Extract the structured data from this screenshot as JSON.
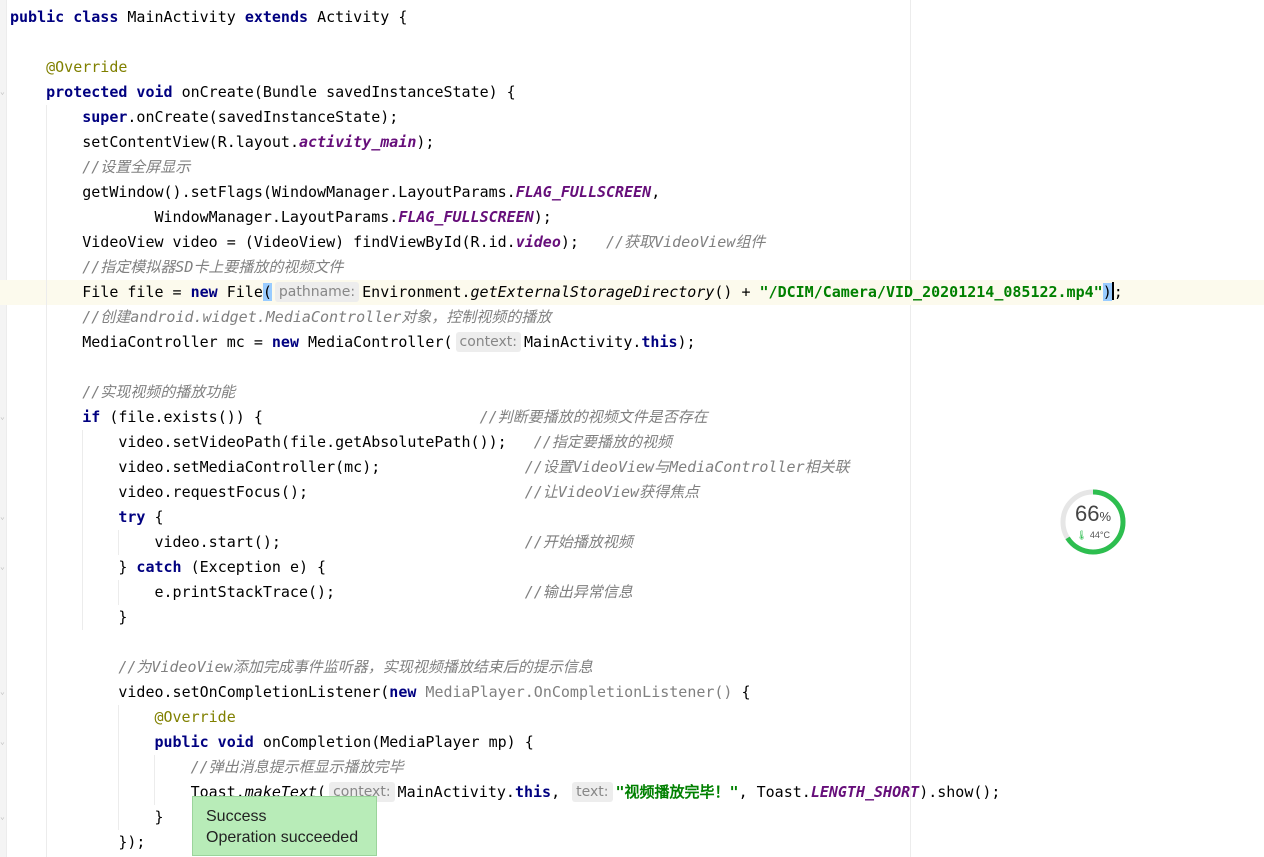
{
  "editor": {
    "lines": [
      {
        "indent": 0,
        "tokens": [
          [
            "kw",
            "public class "
          ],
          [
            "",
            "MainActivity "
          ],
          [
            "kw",
            "extends "
          ],
          [
            "",
            "Activity {"
          ]
        ]
      },
      {
        "indent": 0,
        "tokens": []
      },
      {
        "indent": 4,
        "tokens": [
          [
            "ann",
            "@Override"
          ]
        ]
      },
      {
        "indent": 4,
        "tokens": [
          [
            "kw",
            "protected void "
          ],
          [
            "",
            "onCreate(Bundle savedInstanceState) {"
          ]
        ]
      },
      {
        "indent": 8,
        "tokens": [
          [
            "kw",
            "super"
          ],
          [
            "",
            ".onCreate(savedInstanceState);"
          ]
        ]
      },
      {
        "indent": 8,
        "tokens": [
          [
            "",
            "setContentView(R.layout."
          ],
          [
            "fld",
            "activity_main"
          ],
          [
            "",
            ");"
          ]
        ]
      },
      {
        "indent": 8,
        "tokens": [
          [
            "cm",
            "//设置全屏显示"
          ]
        ]
      },
      {
        "indent": 8,
        "tokens": [
          [
            "",
            "getWindow().setFlags(WindowManager.LayoutParams."
          ],
          [
            "fld",
            "FLAG_FULLSCREEN"
          ],
          [
            "",
            ","
          ]
        ]
      },
      {
        "indent": 16,
        "tokens": [
          [
            "",
            "WindowManager.LayoutParams."
          ],
          [
            "fld",
            "FLAG_FULLSCREEN"
          ],
          [
            "",
            ");"
          ]
        ]
      },
      {
        "indent": 8,
        "tokens": [
          [
            "",
            "VideoView video = (VideoView) findViewById(R.id."
          ],
          [
            "fld",
            "video"
          ],
          [
            "",
            ");   "
          ],
          [
            "cm",
            "//获取VideoView组件"
          ]
        ]
      },
      {
        "indent": 8,
        "tokens": [
          [
            "cm",
            "//指定模拟器SD卡上要播放的视频文件"
          ]
        ]
      },
      {
        "indent": 8,
        "current": true,
        "tokens": [
          [
            "",
            "File file = "
          ],
          [
            "kw",
            "new "
          ],
          [
            "",
            "File"
          ],
          [
            "hl",
            "("
          ],
          [
            "hint",
            "pathname:"
          ],
          [
            "",
            "Environment."
          ],
          [
            "smeth",
            "getExternalStorageDirectory"
          ],
          [
            "",
            "() + "
          ],
          [
            "st",
            "\"/DCIM/Camera/VID_20201214_085122.mp4\""
          ],
          [
            "hl",
            ")"
          ],
          [
            "caret",
            ""
          ],
          [
            "",
            ";"
          ]
        ]
      },
      {
        "indent": 8,
        "tokens": [
          [
            "cm",
            "//创建android.widget.MediaController对象，控制视频的播放"
          ]
        ]
      },
      {
        "indent": 8,
        "tokens": [
          [
            "",
            "MediaController mc = "
          ],
          [
            "kw",
            "new "
          ],
          [
            "",
            "MediaController("
          ],
          [
            "hint",
            "context:"
          ],
          [
            "",
            "MainActivity."
          ],
          [
            "kw",
            "this"
          ],
          [
            "",
            ");"
          ]
        ]
      },
      {
        "indent": 0,
        "tokens": []
      },
      {
        "indent": 8,
        "tokens": [
          [
            "cm",
            "//实现视频的播放功能"
          ]
        ]
      },
      {
        "indent": 8,
        "tokens": [
          [
            "kw",
            "if "
          ],
          [
            "",
            "(file.exists()) {                        "
          ],
          [
            "cm",
            "//判断要播放的视频文件是否存在"
          ]
        ]
      },
      {
        "indent": 12,
        "tokens": [
          [
            "",
            "video.setVideoPath(file.getAbsolutePath());   "
          ],
          [
            "cm",
            "//指定要播放的视频"
          ]
        ]
      },
      {
        "indent": 12,
        "tokens": [
          [
            "",
            "video.setMediaController(mc);                "
          ],
          [
            "cm",
            "//设置VideoView与MediaController相关联"
          ]
        ]
      },
      {
        "indent": 12,
        "tokens": [
          [
            "",
            "video.requestFocus();                        "
          ],
          [
            "cm",
            "//让VideoView获得焦点"
          ]
        ]
      },
      {
        "indent": 12,
        "tokens": [
          [
            "kw",
            "try "
          ],
          [
            "",
            "{"
          ]
        ]
      },
      {
        "indent": 16,
        "tokens": [
          [
            "",
            "video.start();                           "
          ],
          [
            "cm",
            "//开始播放视频"
          ]
        ]
      },
      {
        "indent": 12,
        "tokens": [
          [
            "",
            "} "
          ],
          [
            "kw",
            "catch "
          ],
          [
            "",
            "(Exception e) {"
          ]
        ]
      },
      {
        "indent": 16,
        "tokens": [
          [
            "",
            "e.printStackTrace();                     "
          ],
          [
            "cm",
            "//输出异常信息"
          ]
        ]
      },
      {
        "indent": 12,
        "tokens": [
          [
            "",
            "}"
          ]
        ]
      },
      {
        "indent": 0,
        "tokens": []
      },
      {
        "indent": 12,
        "tokens": [
          [
            "cm",
            "//为VideoView添加完成事件监听器，实现视频播放结束后的提示信息"
          ]
        ]
      },
      {
        "indent": 12,
        "tokens": [
          [
            "",
            "video.setOnCompletionListener("
          ],
          [
            "kw",
            "new "
          ],
          [
            "gray",
            "MediaPlayer.OnCompletionListener() "
          ],
          [
            "",
            "{"
          ]
        ]
      },
      {
        "indent": 16,
        "tokens": [
          [
            "ann",
            "@Override"
          ]
        ]
      },
      {
        "indent": 16,
        "tokens": [
          [
            "kw",
            "public void "
          ],
          [
            "",
            "onCompletion(MediaPlayer mp) {"
          ]
        ]
      },
      {
        "indent": 20,
        "tokens": [
          [
            "cm",
            "//弹出消息提示框显示播放完毕"
          ]
        ]
      },
      {
        "indent": 20,
        "tokens": [
          [
            "",
            "Toast."
          ],
          [
            "smeth",
            "makeText"
          ],
          [
            "",
            "("
          ],
          [
            "hint",
            "context:"
          ],
          [
            "",
            "MainActivity."
          ],
          [
            "kw",
            "this"
          ],
          [
            "",
            ", "
          ],
          [
            "hint",
            "text:"
          ],
          [
            "st",
            "\"视频播放完毕！\""
          ],
          [
            "",
            ", Toast."
          ],
          [
            "fld",
            "LENGTH_SHORT"
          ],
          [
            "",
            ").show();"
          ]
        ]
      },
      {
        "indent": 16,
        "tokens": [
          [
            "",
            "}"
          ]
        ]
      },
      {
        "indent": 12,
        "tokens": [
          [
            "",
            "});"
          ]
        ]
      }
    ]
  },
  "toast": {
    "title": "Success",
    "message": "Operation succeeded"
  },
  "gauge": {
    "percent_value": "66",
    "percent_unit": "%",
    "temperature": "44°C",
    "fraction": 0.66,
    "color": "#2dbe4f"
  }
}
